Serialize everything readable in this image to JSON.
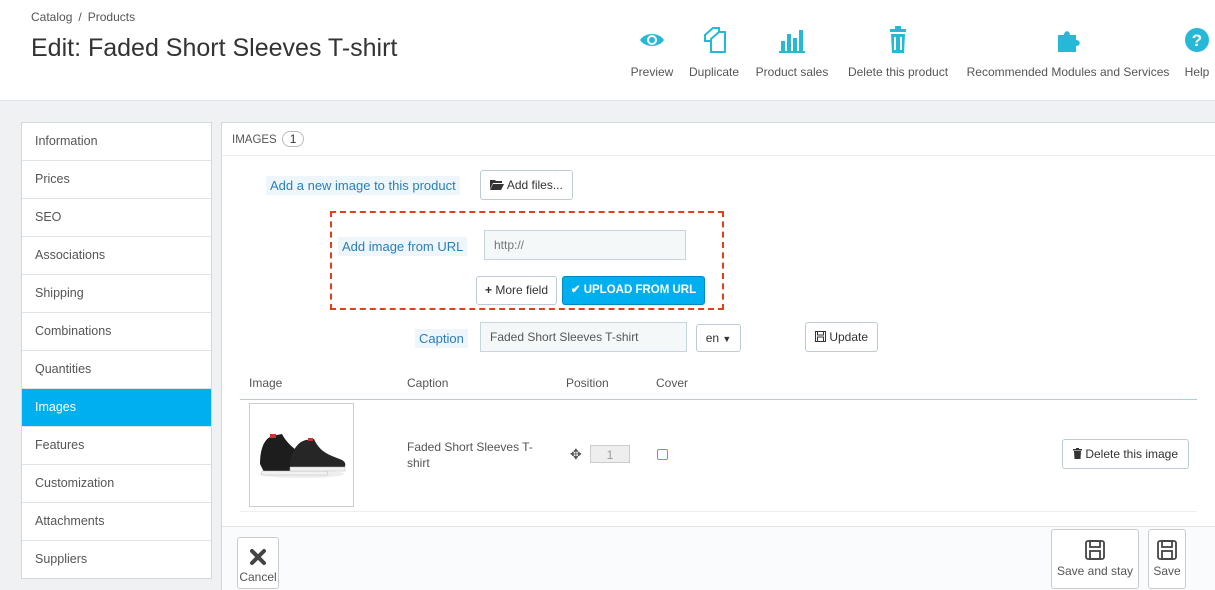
{
  "breadcrumb": {
    "root": "Catalog",
    "separator": "/",
    "current": "Products"
  },
  "page_title": "Edit: Faded Short Sleeves T-shirt",
  "toolbar": [
    {
      "label": "Preview",
      "icon": "eye-icon"
    },
    {
      "label": "Duplicate",
      "icon": "duplicate-icon"
    },
    {
      "label": "Product sales",
      "icon": "bar-chart-icon"
    },
    {
      "label": "Delete this product",
      "icon": "trash-icon"
    },
    {
      "label": "Recommended Modules and Services",
      "icon": "puzzle-icon"
    },
    {
      "label": "Help",
      "icon": "help-icon"
    }
  ],
  "sidebar": {
    "items": [
      {
        "label": "Information"
      },
      {
        "label": "Prices"
      },
      {
        "label": "SEO"
      },
      {
        "label": "Associations"
      },
      {
        "label": "Shipping"
      },
      {
        "label": "Combinations"
      },
      {
        "label": "Quantities"
      },
      {
        "label": "Images",
        "active": true
      },
      {
        "label": "Features"
      },
      {
        "label": "Customization"
      },
      {
        "label": "Attachments"
      },
      {
        "label": "Suppliers"
      }
    ]
  },
  "images_panel": {
    "heading": "IMAGES",
    "count": "1",
    "add_new_label": "Add a new image to this product",
    "add_files_label": "Add files...",
    "add_from_url_label": "Add image from URL",
    "url_placeholder": "http://",
    "more_field_label": "More field",
    "upload_from_url_label": "UPLOAD FROM URL",
    "caption_label": "Caption",
    "caption_value": "Faded Short Sleeves T-shirt",
    "language": "en",
    "update_label": "Update"
  },
  "table": {
    "headers": [
      "Image",
      "Caption",
      "Position",
      "Cover"
    ],
    "rows": [
      {
        "caption": "Faded Short Sleeves T-shirt",
        "position": "1",
        "cover": false,
        "delete_label": "Delete this image"
      }
    ]
  },
  "footer": {
    "cancel_label": "Cancel",
    "save_and_stay_label": "Save and stay",
    "save_label": "Save"
  },
  "colors": {
    "accent": "#00aff0",
    "highlight_border": "#e0401a",
    "link_label": "#2a7fb8"
  }
}
